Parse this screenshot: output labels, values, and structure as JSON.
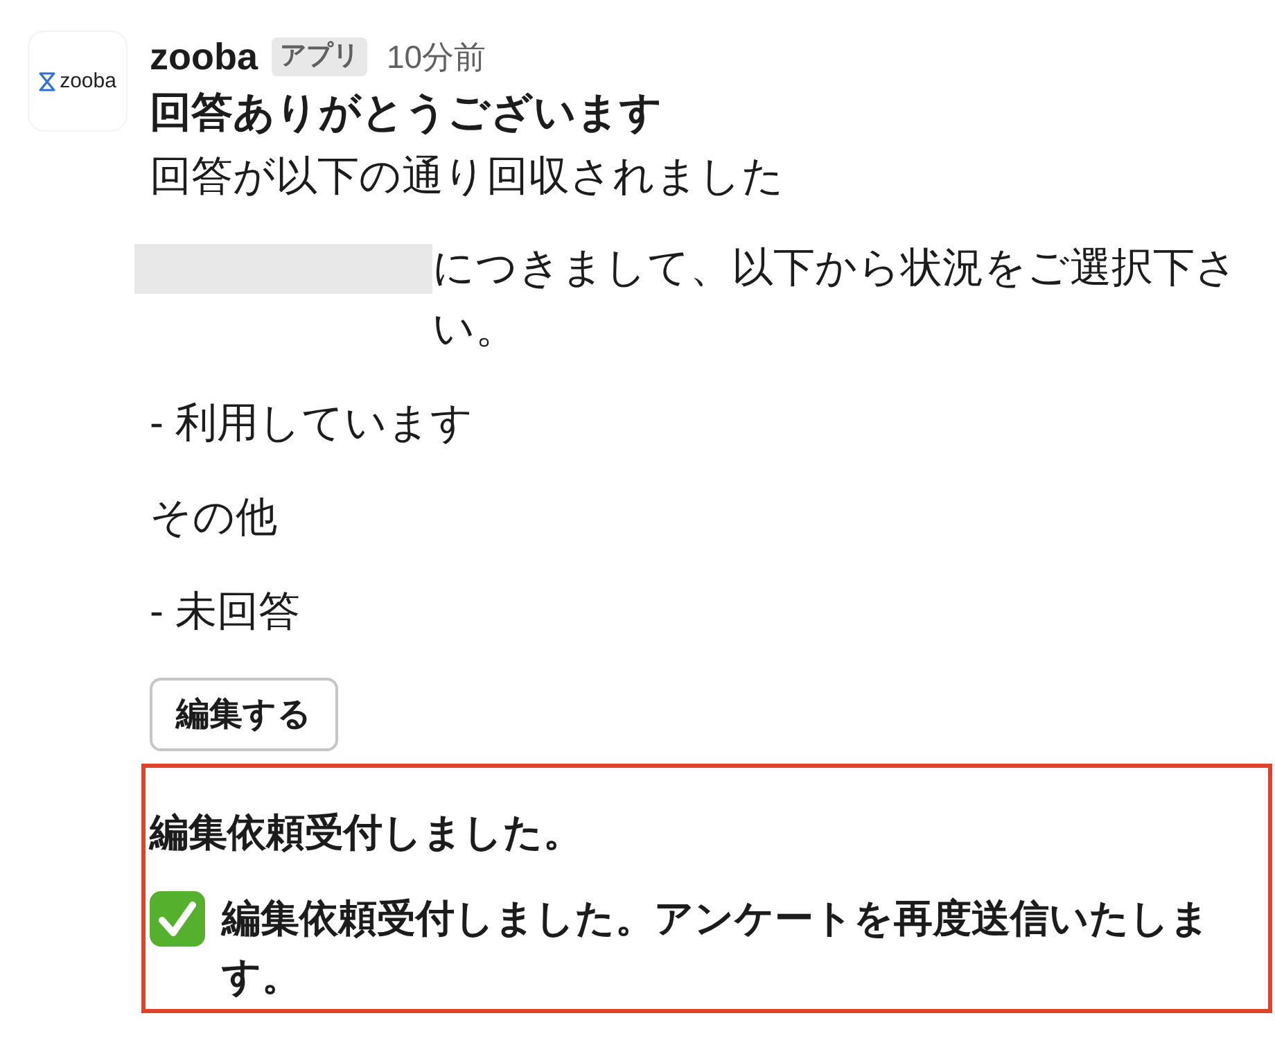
{
  "message": {
    "avatar": {
      "logo_text": "zooba"
    },
    "sender": "zooba",
    "badge": "アプリ",
    "time": "10分前",
    "title": "回答ありがとうございます",
    "subtitle": "回答が以下の通り回収されました",
    "blocks": [
      {
        "kind": "redacted_text",
        "text": "につきまして、以下から状況をご選択下さい。"
      },
      {
        "kind": "text",
        "text": "- 利用しています"
      },
      {
        "kind": "text",
        "text": "その他"
      },
      {
        "kind": "text",
        "text": "- 未回答"
      }
    ],
    "button": {
      "label": "編集する"
    },
    "highlighted_reply": {
      "heading": "編集依頼受付しました。",
      "confirmation": "編集依頼受付しました。アンケートを再度送信いたします。"
    }
  }
}
